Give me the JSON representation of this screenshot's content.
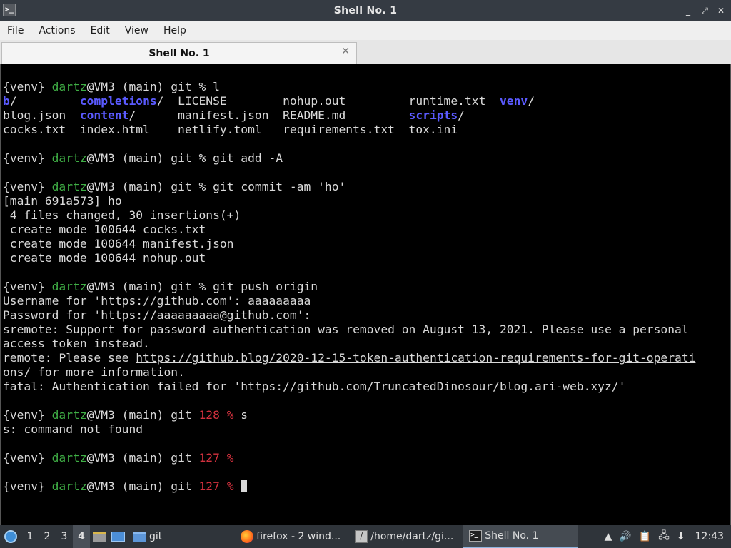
{
  "window": {
    "title": "Shell No. 1",
    "controls": [
      "_",
      "⤢",
      "✕"
    ]
  },
  "menu": [
    "File",
    "Actions",
    "Edit",
    "View",
    "Help"
  ],
  "tab": {
    "label": "Shell No. 1",
    "close": "✕"
  },
  "terminal": {
    "lines": [
      [
        {
          "t": "{venv} "
        },
        {
          "t": "dartz",
          "c": "green"
        },
        {
          "t": "@VM3 (main) git % l"
        }
      ],
      [
        {
          "t": "b",
          "c": "blue"
        },
        {
          "t": "/         "
        },
        {
          "t": "completions",
          "c": "blue"
        },
        {
          "t": "/  LICENSE        nohup.out         runtime.txt  "
        },
        {
          "t": "venv",
          "c": "blue"
        },
        {
          "t": "/"
        }
      ],
      [
        {
          "t": "blog.json  "
        },
        {
          "t": "content",
          "c": "blue"
        },
        {
          "t": "/      manifest.json  README.md         "
        },
        {
          "t": "scripts",
          "c": "blue"
        },
        {
          "t": "/"
        }
      ],
      [
        {
          "t": "cocks.txt  index.html    netlify.toml   requirements.txt  tox.ini"
        }
      ],
      [
        {
          "t": ""
        }
      ],
      [
        {
          "t": "{venv} "
        },
        {
          "t": "dartz",
          "c": "green"
        },
        {
          "t": "@VM3 (main) git % git add -A"
        }
      ],
      [
        {
          "t": ""
        }
      ],
      [
        {
          "t": "{venv} "
        },
        {
          "t": "dartz",
          "c": "green"
        },
        {
          "t": "@VM3 (main) git % git commit -am 'ho'"
        }
      ],
      [
        {
          "t": "[main 691a573] ho"
        }
      ],
      [
        {
          "t": " 4 files changed, 30 insertions(+)"
        }
      ],
      [
        {
          "t": " create mode 100644 cocks.txt"
        }
      ],
      [
        {
          "t": " create mode 100644 manifest.json"
        }
      ],
      [
        {
          "t": " create mode 100644 nohup.out"
        }
      ],
      [
        {
          "t": ""
        }
      ],
      [
        {
          "t": "{venv} "
        },
        {
          "t": "dartz",
          "c": "green"
        },
        {
          "t": "@VM3 (main) git % git push origin"
        }
      ],
      [
        {
          "t": "Username for 'https://github.com': aaaaaaaaa"
        }
      ],
      [
        {
          "t": "Password for 'https://aaaaaaaaa@github.com':"
        }
      ],
      [
        {
          "t": "sremote: Support for password authentication was removed on August 13, 2021. Please use a personal"
        }
      ],
      [
        {
          "t": "access token instead."
        }
      ],
      [
        {
          "t": "remote: Please see "
        },
        {
          "t": "https://github.blog/2020-12-15-token-authentication-requirements-for-git-operati",
          "c": "link"
        }
      ],
      [
        {
          "t": "ons/",
          "c": "link"
        },
        {
          "t": " for more information."
        }
      ],
      [
        {
          "t": "fatal: Authentication failed for 'https://github.com/TruncatedDinosour/blog.ari-web.xyz/'"
        }
      ],
      [
        {
          "t": ""
        }
      ],
      [
        {
          "t": "{venv} "
        },
        {
          "t": "dartz",
          "c": "green"
        },
        {
          "t": "@VM3 (main) git "
        },
        {
          "t": "128 %",
          "c": "red"
        },
        {
          "t": " s"
        }
      ],
      [
        {
          "t": "s: command not found"
        }
      ],
      [
        {
          "t": ""
        }
      ],
      [
        {
          "t": "{venv} "
        },
        {
          "t": "dartz",
          "c": "green"
        },
        {
          "t": "@VM3 (main) git "
        },
        {
          "t": "127 %",
          "c": "red"
        }
      ],
      [
        {
          "t": ""
        }
      ],
      [
        {
          "t": "{venv} "
        },
        {
          "t": "dartz",
          "c": "green"
        },
        {
          "t": "@VM3 (main) git "
        },
        {
          "t": "127 %",
          "c": "red"
        },
        {
          "t": " "
        },
        {
          "t": "",
          "c": "cursor"
        }
      ]
    ]
  },
  "taskbar": {
    "workspaces": [
      "1",
      "2",
      "3",
      "4"
    ],
    "active_workspace": "4",
    "folder_label": "git",
    "tasks": [
      {
        "label": "firefox - 2 wind...",
        "icon": "firefox-icon"
      },
      {
        "label": "/home/dartz/gi...",
        "icon": "text-editor-icon"
      },
      {
        "label": "Shell No. 1",
        "icon": "terminal-icon"
      }
    ],
    "tray": {
      "icons": [
        "▲",
        "🔊",
        "📋",
        "🖧",
        "⬇"
      ],
      "clock": "12:43"
    }
  }
}
